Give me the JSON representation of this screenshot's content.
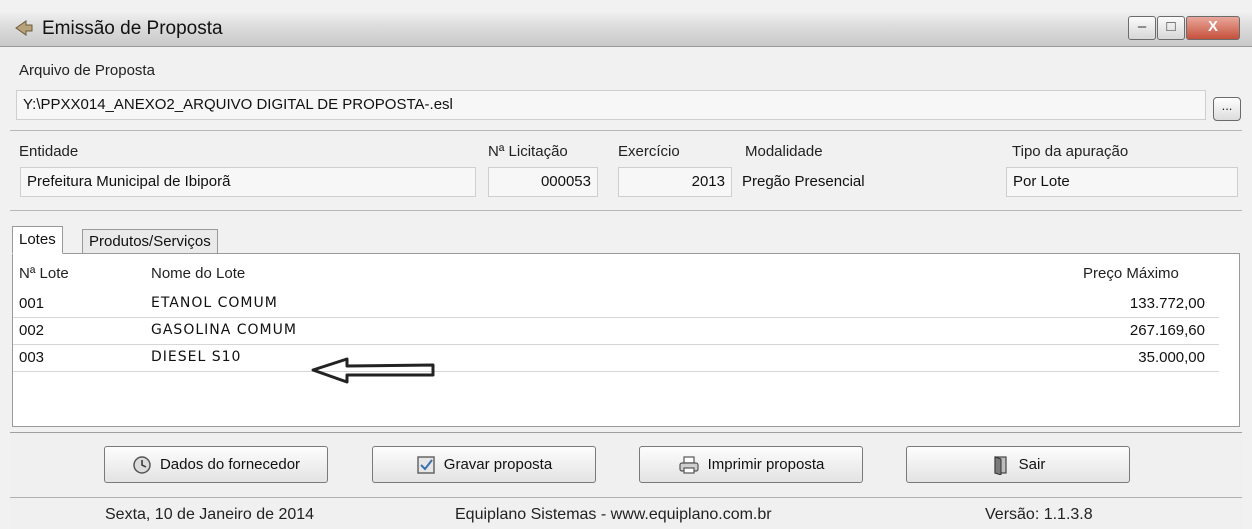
{
  "window": {
    "title": "Emissão de Proposta",
    "minimize": "–",
    "maximize": "□",
    "close": "X"
  },
  "arquivo": {
    "label": "Arquivo de Proposta",
    "value": "Y:\\PPXX014_ANEXO2_ARQUIVO DIGITAL DE PROPOSTA-.esl",
    "browse": "..."
  },
  "info": {
    "entidade_label": "Entidade",
    "entidade_value": "Prefeitura Municipal de Ibiporã",
    "licitacao_label": "Nª Licitação",
    "licitacao_value": "000053",
    "exercicio_label": "Exercício",
    "exercicio_value": "2013",
    "modalidade_label": "Modalidade",
    "modalidade_value": "Pregão Presencial",
    "apuracao_label": "Tipo da apuração",
    "apuracao_value": "Por Lote"
  },
  "tabs": [
    {
      "label": "Lotes",
      "active": true
    },
    {
      "label": "Produtos/Serviços",
      "active": false
    }
  ],
  "table": {
    "headers": [
      "Nª Lote",
      "Nome do Lote",
      "Preço Máximo"
    ],
    "rows": [
      [
        "001",
        "ETANOL COMUM",
        "133.772,00"
      ],
      [
        "002",
        "GASOLINA COMUM",
        "267.169,60"
      ],
      [
        "003",
        "DIESEL S10",
        "35.000,00"
      ]
    ]
  },
  "buttons": {
    "dados": "Dados do fornecedor",
    "gravar": "Gravar proposta",
    "imprimir": "Imprimir proposta",
    "sair": "Sair"
  },
  "status": {
    "date": "Sexta, 10 de Janeiro de 2014",
    "company": "Equiplano Sistemas - www.equiplano.com.br",
    "version": "Versão: 1.1.3.8"
  },
  "icons": {
    "app": "app-icon",
    "annotation": "arrow-left-icon",
    "dados": "clock-icon",
    "gravar": "checkbox-icon",
    "imprimir": "printer-icon",
    "sair": "door-exit-icon"
  }
}
